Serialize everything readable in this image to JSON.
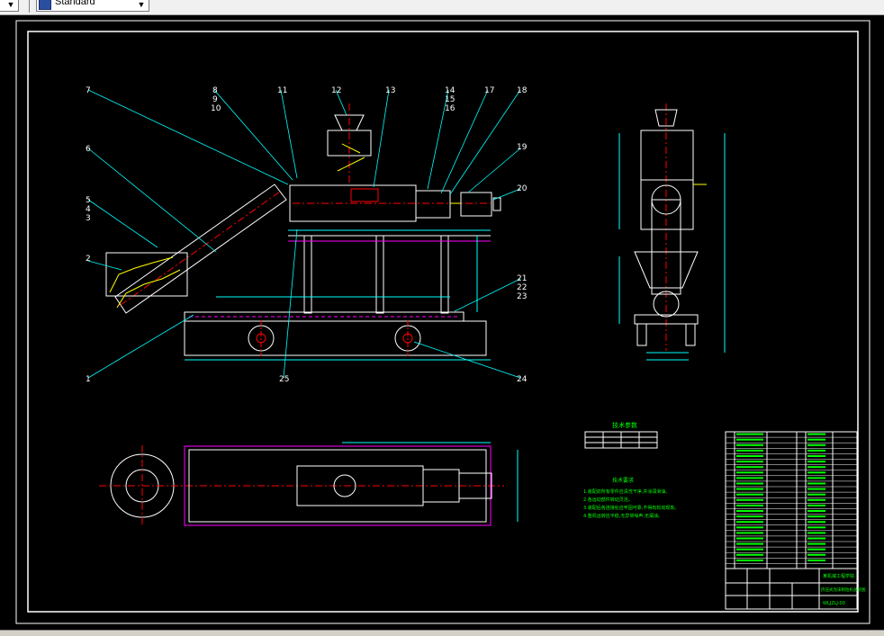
{
  "toolbar": {
    "text_style_value": "Standard"
  },
  "drawing": {
    "callouts": [
      "1",
      "2",
      "3",
      "4",
      "5",
      "6",
      "7",
      "8",
      "9",
      "10",
      "11",
      "12",
      "13",
      "14",
      "15",
      "16",
      "17",
      "18",
      "19",
      "20",
      "21",
      "22",
      "23",
      "24",
      "25"
    ],
    "table_heading": "技术参数",
    "notes_heading": "技术要求",
    "notes": [
      "1.装配前所有零件应清洗干净,并涂润滑油。",
      "2.各运动部件转动灵活。",
      "3.装配后各连接处应牢固可靠,不得有松动现象。",
      "4.整机运转应平稳,无异常噪声,无漏油。"
    ],
    "title_block": {
      "school": "某机械工程学院",
      "drawing_name": "挤压式泡沫制粒机总装图",
      "drawing_no": "WLJZLJ-00"
    },
    "colors": {
      "cyan": "#00ffff",
      "yellow": "#ffff00",
      "white": "#ffffff",
      "red": "#ff0000",
      "magenta": "#ff00ff",
      "green": "#00ff00",
      "frame": "#ffffff"
    }
  }
}
